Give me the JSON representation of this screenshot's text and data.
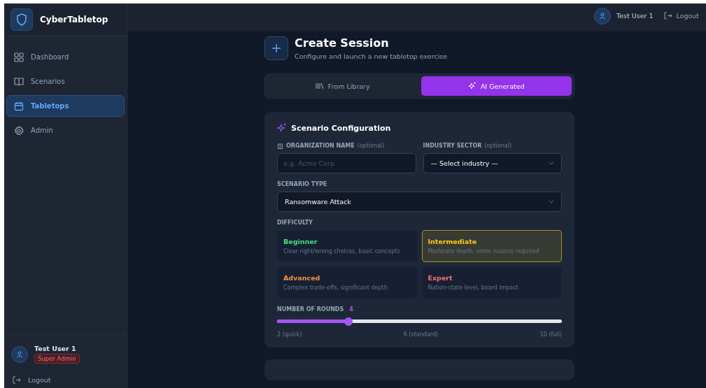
{
  "app": {
    "name": "CyberTabletop"
  },
  "sidebar": {
    "items": [
      {
        "label": "Dashboard",
        "selected": false
      },
      {
        "label": "Scenarios",
        "selected": false
      },
      {
        "label": "Tabletops",
        "selected": true
      },
      {
        "label": "Admin",
        "selected": false
      }
    ],
    "user": {
      "name": "Test User 1",
      "role": "Super Admin"
    },
    "logout": "Logout"
  },
  "topbar": {
    "user": "Test User 1",
    "logout": "Logout"
  },
  "page": {
    "title": "Create Session",
    "subtitle": "Configure and launch a new tabletop exercise"
  },
  "tabs": [
    {
      "label": "From Library",
      "selected": false
    },
    {
      "label": "AI Generated",
      "selected": true
    }
  ],
  "config": {
    "title": "Scenario Configuration",
    "org": {
      "label": "ORGANIZATION NAME",
      "hint": "(optional)",
      "placeholder": "e.g. Acme Corp"
    },
    "industry": {
      "label": "INDUSTRY SECTOR",
      "hint": "(optional)",
      "value": "— Select industry —"
    },
    "scenario": {
      "label": "SCENARIO TYPE",
      "value": "Ransomware Attack"
    },
    "difficulty": {
      "label": "DIFFICULTY",
      "options": [
        {
          "name": "Beginner",
          "desc": "Clear right/wrong choices, basic concepts",
          "color": "#4ade80",
          "selected": false
        },
        {
          "name": "Intermediate",
          "desc": "Moderate depth, some nuance required",
          "color": "#facc15",
          "selected": true
        },
        {
          "name": "Advanced",
          "desc": "Complex trade-offs, significant depth",
          "color": "#fb923c",
          "selected": false
        },
        {
          "name": "Expert",
          "desc": "Nation-state level, board impact",
          "color": "#f87171",
          "selected": false
        }
      ]
    },
    "rounds": {
      "label": "NUMBER OF ROUNDS",
      "value": "4",
      "level": 0.25,
      "ticks": [
        "2 (quick)",
        "6 (standard)",
        "10 (full)"
      ]
    }
  }
}
